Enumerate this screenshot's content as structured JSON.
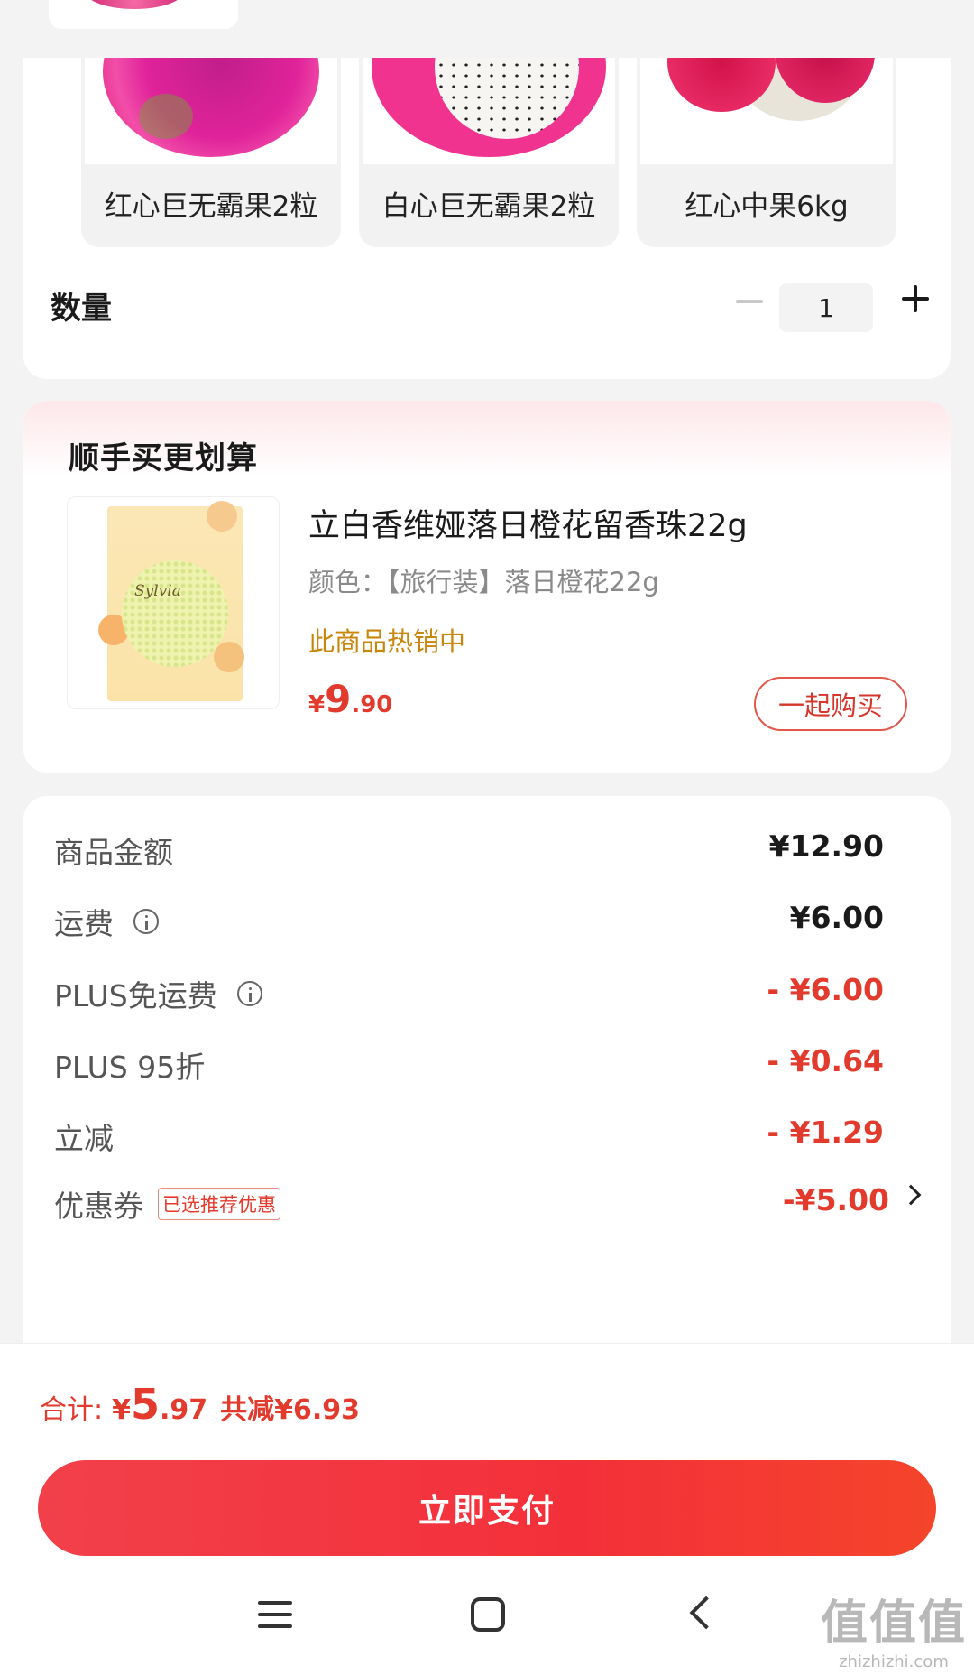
{
  "spec": {
    "options": [
      {
        "label": "红心巨无霸果2粒"
      },
      {
        "label": "白心巨无霸果2粒"
      },
      {
        "label": "红心中果6kg"
      }
    ],
    "quantity_label": "数量",
    "quantity_value": "1"
  },
  "bundle": {
    "title": "顺手买更划算",
    "product_name": "立白香维娅落日橙花留香珠22g",
    "product_color": "颜色：【旅行装】落日橙花22g",
    "hot_text": "此商品热销中",
    "price_symbol": "¥",
    "price_int": "9",
    "price_dec": ".90",
    "buy_button": "一起购买",
    "package_brand": "Sylvia"
  },
  "summary": {
    "rows": [
      {
        "label": "商品金额",
        "value": "¥12.90"
      },
      {
        "label": "运费",
        "value": "¥6.00"
      },
      {
        "label": "PLUS免运费",
        "value": "- ¥6.00"
      },
      {
        "label": "PLUS 95折",
        "value": "- ¥0.64"
      },
      {
        "label": "立减",
        "value": "- ¥1.29"
      },
      {
        "label": "优惠券",
        "tag": "已选推荐优惠",
        "value": "-¥5.00"
      }
    ]
  },
  "total": {
    "label": "合计:",
    "symbol": "¥",
    "int": "5",
    "dec": ".97",
    "saved": "共减¥6.93"
  },
  "pay_button": "立即支付",
  "watermark": {
    "big": "值值值",
    "small": "zhizhizhi.com"
  },
  "colors": {
    "accent_red": "#e23b2e",
    "hot_orange": "#c8860a",
    "pay_gradient_start": "#f2404a",
    "pay_gradient_end": "#f4442a"
  }
}
